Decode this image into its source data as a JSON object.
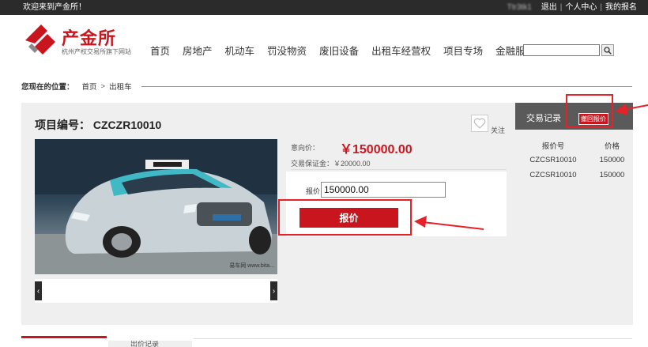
{
  "topbar": {
    "welcome": "欢迎来到产金所！",
    "username": "Ttr3tk1",
    "logout": "退出",
    "user_center": "个人中心",
    "my_signup": "我的报名",
    "sep": "|"
  },
  "logo": {
    "name": "产金所",
    "sub": "杭州产权交易所旗下网站",
    "brand_color": "#c9151e"
  },
  "nav": [
    "首页",
    "房地产",
    "机动车",
    "罚没物资",
    "废旧设备",
    "出租车经营权",
    "项目专场",
    "金融服务"
  ],
  "search": {
    "placeholder": "",
    "icon": "search-icon"
  },
  "breadcrumb": {
    "here": "您现在的位置：",
    "home": "首页",
    "gt": ">",
    "current": "出租车"
  },
  "project": {
    "title": "项目编号： CZCZR10010",
    "favorite": "关注",
    "intended_label": "意向价：",
    "intended_price": "￥150000.00",
    "deposit": "交易保证金：￥20000.00",
    "bid_label": "报价",
    "bid_value": "150000.00",
    "bid_button": "报价",
    "photo_watermark": "易车网 www.bita..."
  },
  "records": {
    "title": "交易记录",
    "cancel_button": "撤回报价",
    "headers": [
      "报价号",
      "价格"
    ],
    "rows": [
      [
        "CZCSR10010",
        "150000"
      ],
      [
        "CZCSR10010",
        "150000"
      ]
    ]
  },
  "bottom": {
    "tab2": "出价记录"
  }
}
